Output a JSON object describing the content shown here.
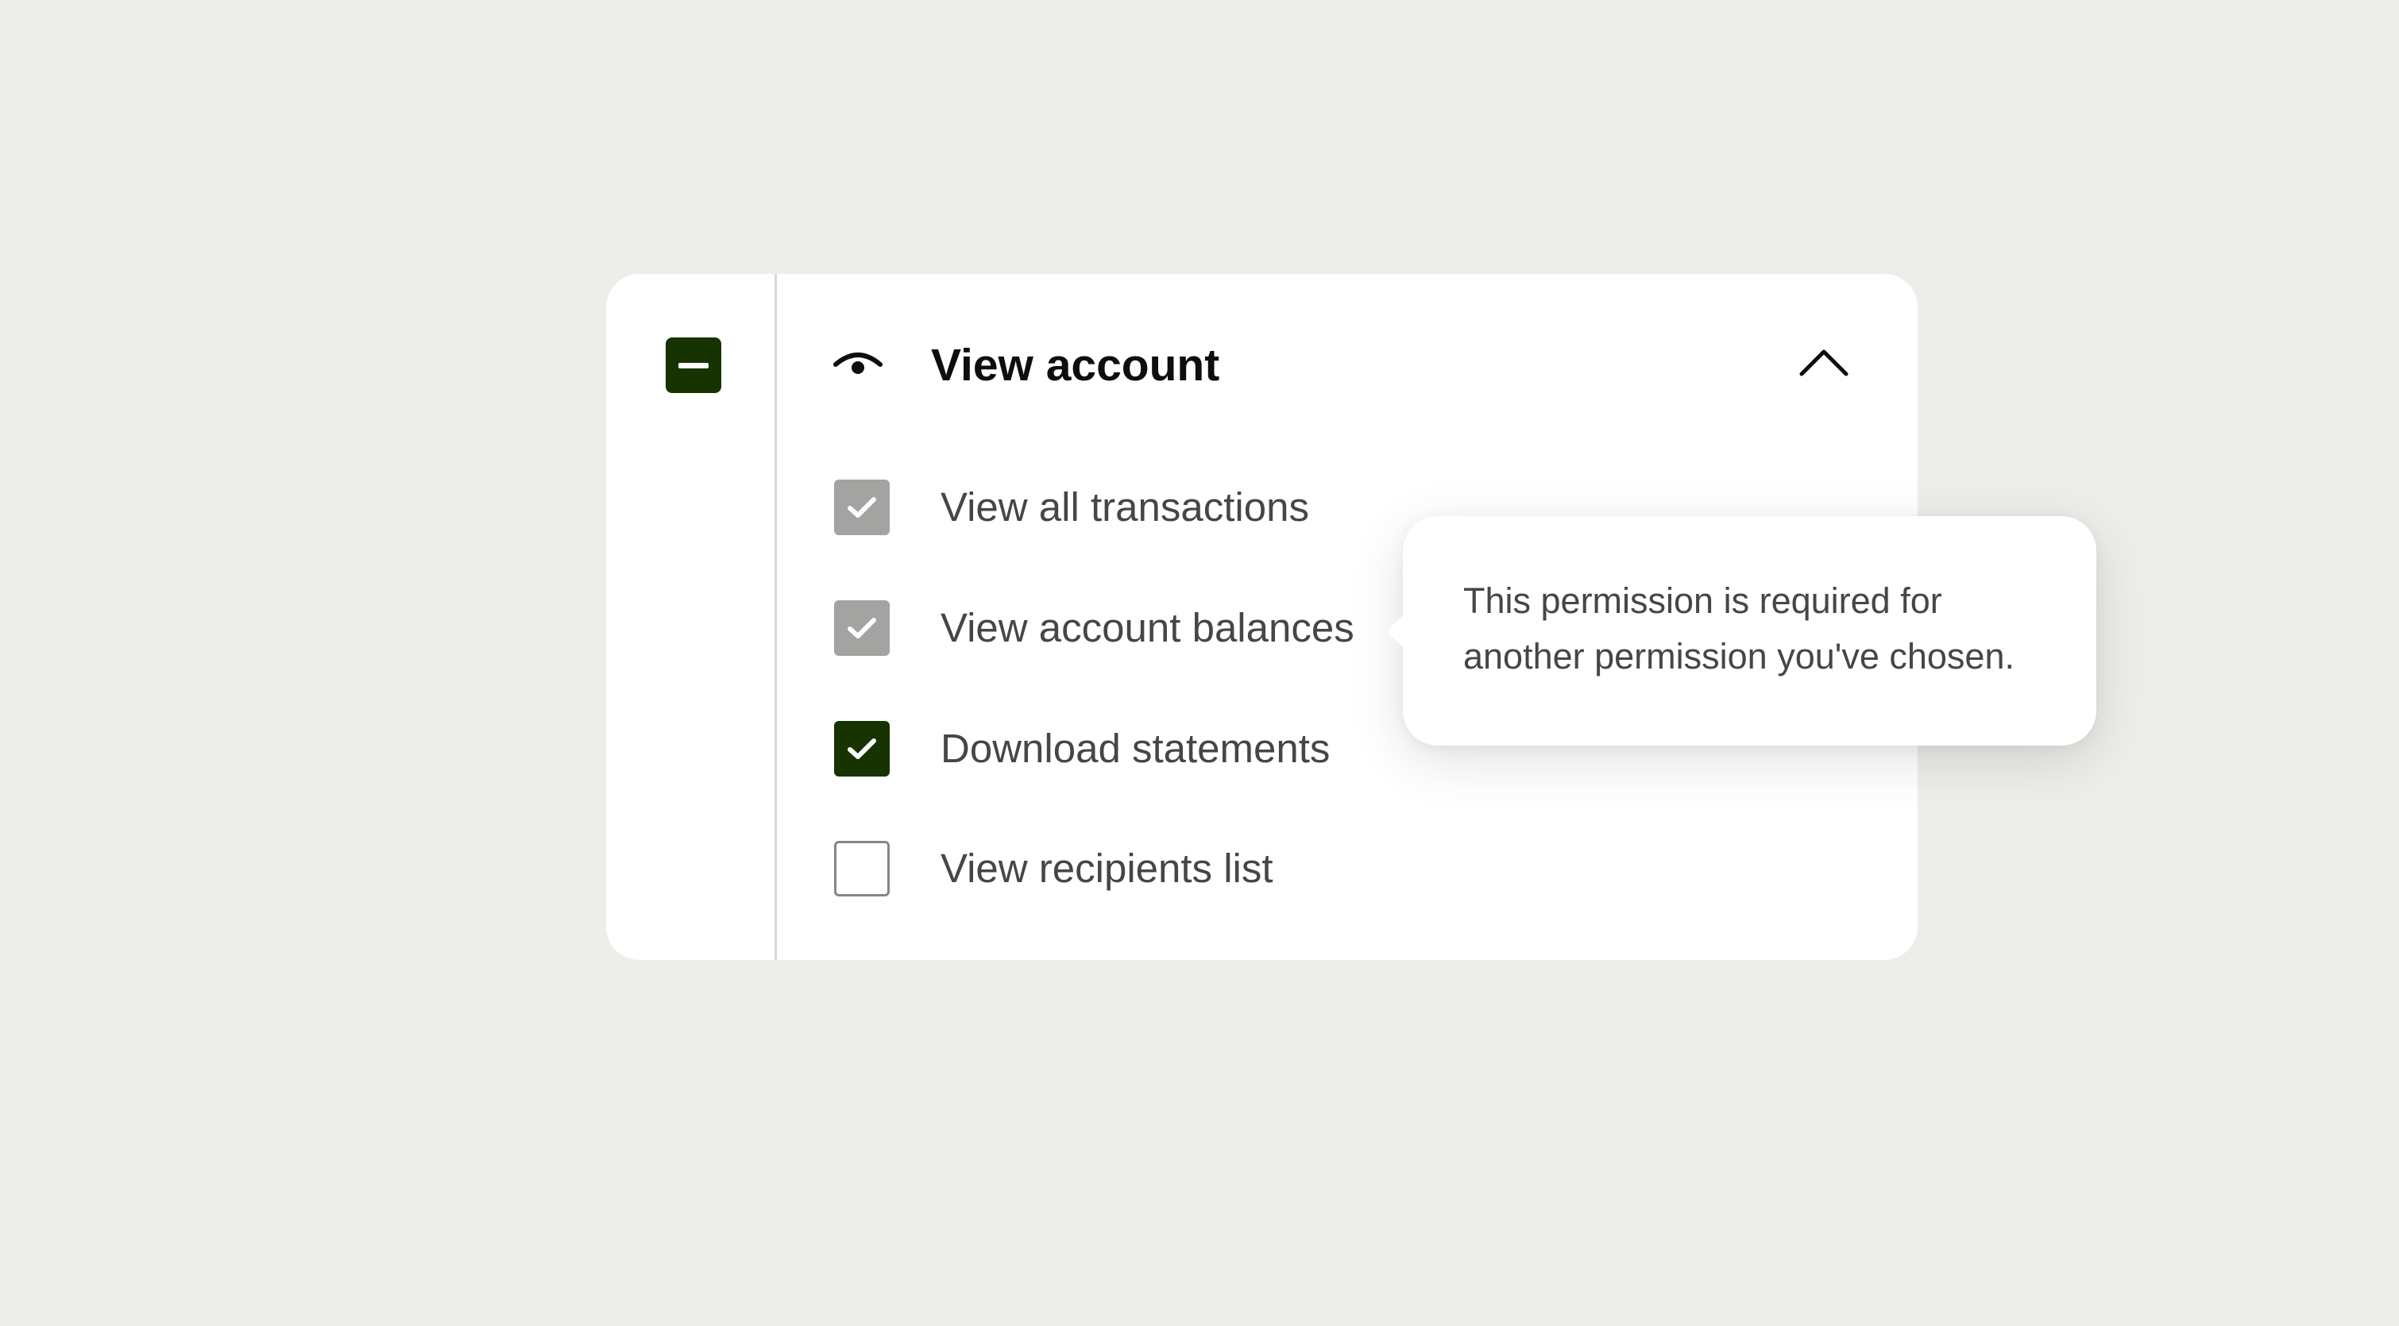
{
  "colors": {
    "background": "#EDEEEA",
    "card": "#FFFFFF",
    "primary_green": "#163300",
    "disabled_gray": "#A3A3A1",
    "text_primary": "#0E0F0C",
    "text_secondary": "#454745"
  },
  "parent_checkbox": {
    "state": "indeterminate",
    "icon": "minus-icon"
  },
  "header": {
    "icon": "eye-icon",
    "title": "View account",
    "toggle_icon": "chevron-up-icon",
    "expanded": true
  },
  "permissions": [
    {
      "label": "View all transactions",
      "state": "checked-disabled"
    },
    {
      "label": "View account balances",
      "state": "checked-disabled"
    },
    {
      "label": "Download statements",
      "state": "checked"
    },
    {
      "label": "View recipients list",
      "state": "unchecked"
    }
  ],
  "tooltip": {
    "text": "This permission is required for another permission you've chosen."
  }
}
